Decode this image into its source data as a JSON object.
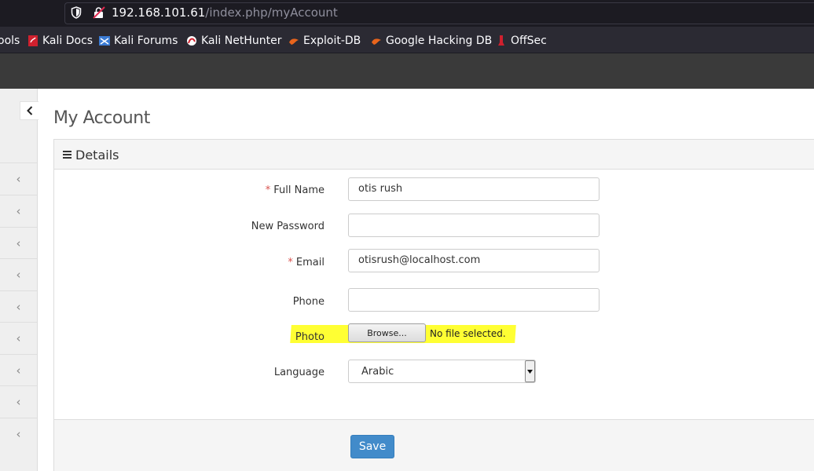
{
  "browser": {
    "url_host": "192.168.101.61",
    "url_path": "/index.php/myAccount",
    "bookmarks": [
      {
        "label": "ools",
        "icon": "none"
      },
      {
        "label": "Kali Docs",
        "icon": "kali-docs-icon"
      },
      {
        "label": "Kali Forums",
        "icon": "kali-forums-icon"
      },
      {
        "label": "Kali NetHunter",
        "icon": "kali-nethunter-icon"
      },
      {
        "label": "Exploit-DB",
        "icon": "exploit-db-icon"
      },
      {
        "label": "Google Hacking DB",
        "icon": "google-hacking-db-icon"
      },
      {
        "label": "OffSec",
        "icon": "offsec-icon"
      }
    ]
  },
  "page": {
    "title": "My Account"
  },
  "panel": {
    "title": "Details"
  },
  "form": {
    "required_mark": "*",
    "full_name_label": "Full Name",
    "full_name_value": "otis rush",
    "new_password_label": "New Password",
    "new_password_value": "",
    "email_label": "Email",
    "email_value": "otisrush@localhost.com",
    "phone_label": "Phone",
    "phone_value": "",
    "photo_label": "Photo",
    "browse_label": "Browse...",
    "no_file_text": "No file selected.",
    "language_label": "Language",
    "language_value": "Arabic",
    "save_label": "Save"
  },
  "colors": {
    "primary_button": "#428bca",
    "required": "#d9534f",
    "highlight": "#ffff33"
  }
}
